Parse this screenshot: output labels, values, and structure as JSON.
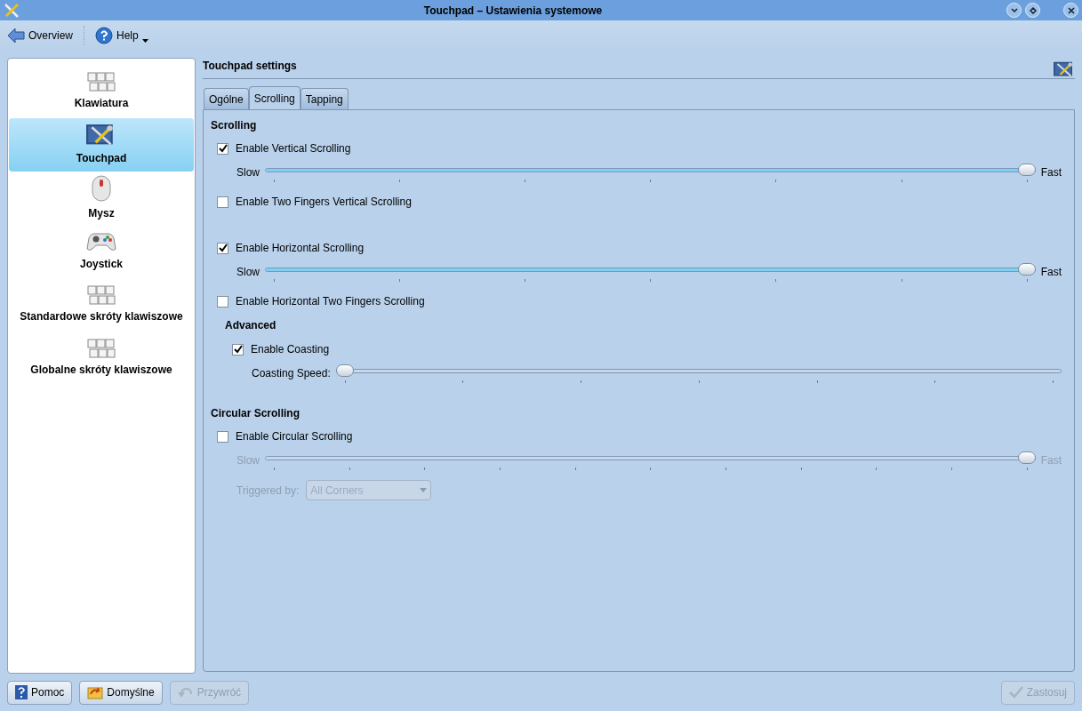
{
  "window": {
    "title": "Touchpad – Ustawienia systemowe"
  },
  "toolbar": {
    "overview": "Overview",
    "help": "Help"
  },
  "sidebar": {
    "items": [
      {
        "label": "Klawiatura",
        "selected": false
      },
      {
        "label": "Touchpad",
        "selected": true
      },
      {
        "label": "Mysz",
        "selected": false
      },
      {
        "label": "Joystick",
        "selected": false
      },
      {
        "label": "Standardowe skróty klawiszowe",
        "selected": false
      },
      {
        "label": "Globalne skróty klawiszowe",
        "selected": false
      }
    ]
  },
  "header": {
    "title": "Touchpad settings"
  },
  "tabs": [
    {
      "label": "Ogólne",
      "selected": false
    },
    {
      "label": "Scrolling",
      "selected": true
    },
    {
      "label": "Tapping",
      "selected": false
    }
  ],
  "sections": [
    {
      "title": "Scrolling",
      "items": [
        {
          "kind": "checkbox",
          "label": "Enable Vertical Scrolling",
          "checked": true
        },
        {
          "kind": "slider",
          "min_label": "Slow",
          "max_label": "Fast",
          "level": 1,
          "disabled": false
        },
        {
          "kind": "checkbox",
          "label": "Enable Two Fingers Vertical Scrolling",
          "checked": false
        },
        {
          "kind": "spacer"
        },
        {
          "kind": "checkbox",
          "label": "Enable Horizontal Scrolling",
          "checked": true
        },
        {
          "kind": "slider",
          "min_label": "Slow",
          "max_label": "Fast",
          "level": 1,
          "disabled": false
        },
        {
          "kind": "checkbox",
          "label": "Enable Horizontal Two Fingers Scrolling",
          "checked": false
        },
        {
          "kind": "group",
          "title": "Advanced",
          "children": [
            {
              "kind": "checkbox",
              "label": "Enable Coasting",
              "checked": true
            },
            {
              "kind": "slider",
              "min_label": "Coasting Speed:",
              "level": 0,
              "disabled": false
            }
          ]
        }
      ]
    },
    {
      "title": "Circular Scrolling",
      "items": [
        {
          "kind": "checkbox",
          "label": "Enable Circular Scrolling",
          "checked": false
        },
        {
          "kind": "slider",
          "min_label": "Slow",
          "max_label": "Fast",
          "level": 1,
          "disabled": true
        },
        {
          "kind": "combo",
          "label": "Triggered by:",
          "value": "All Corners",
          "disabled": true
        }
      ]
    }
  ],
  "buttons": {
    "left": [
      {
        "label": "Pomoc",
        "disabled": false
      },
      {
        "label": "Domyślne",
        "disabled": false
      },
      {
        "label": "Przywróć",
        "disabled": true
      }
    ],
    "right": [
      {
        "label": "Zastosuj",
        "disabled": true
      }
    ]
  }
}
